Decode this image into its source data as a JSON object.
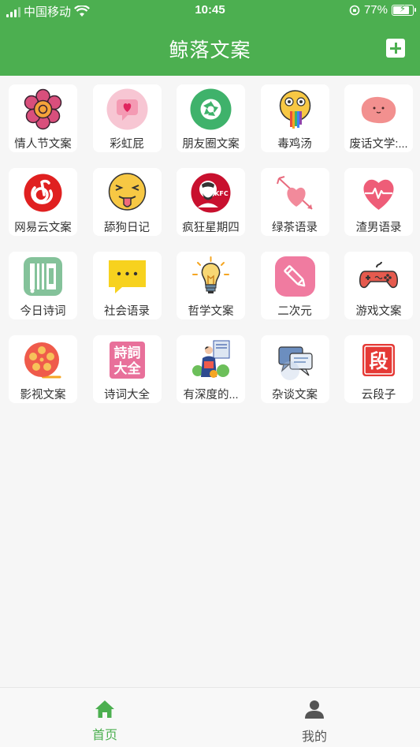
{
  "status_bar": {
    "carrier": "中国移动",
    "time": "10:45",
    "battery": "77%",
    "battery_level": 0.77
  },
  "header": {
    "title": "鲸落文案",
    "add_icon": "plus-square-icon"
  },
  "categories": [
    {
      "label": "情人节文案",
      "icon": "flower-icon"
    },
    {
      "label": "彩虹屁",
      "icon": "heart-chat-icon"
    },
    {
      "label": "朋友圈文案",
      "icon": "camera-aperture-icon"
    },
    {
      "label": "毒鸡汤",
      "icon": "rainbow-vomit-emoji-icon"
    },
    {
      "label": "废话文学:...",
      "icon": "pink-blob-face-icon"
    },
    {
      "label": "网易云文案",
      "icon": "netease-music-icon"
    },
    {
      "label": "舔狗日记",
      "icon": "tongue-out-emoji-icon"
    },
    {
      "label": "疯狂星期四",
      "icon": "kfc-icon"
    },
    {
      "label": "绿茶语录",
      "icon": "heart-arrow-icon"
    },
    {
      "label": "渣男语录",
      "icon": "heartbeat-icon"
    },
    {
      "label": "今日诗词",
      "icon": "poem-scroll-icon"
    },
    {
      "label": "社会语录",
      "icon": "speech-bubble-dots-icon"
    },
    {
      "label": "哲学文案",
      "icon": "lightbulb-icon"
    },
    {
      "label": "二次元",
      "icon": "pencil-icon"
    },
    {
      "label": "游戏文案",
      "icon": "gamepad-icon"
    },
    {
      "label": "影视文案",
      "icon": "film-reel-icon"
    },
    {
      "label": "诗词大全",
      "icon": "poetry-book-icon"
    },
    {
      "label": "有深度的...",
      "icon": "reading-person-icon"
    },
    {
      "label": "杂谈文案",
      "icon": "chat-bubbles-icon"
    },
    {
      "label": "云段子",
      "icon": "duan-character-icon"
    }
  ],
  "tabbar": {
    "home": {
      "label": "首页",
      "icon": "home-icon"
    },
    "me": {
      "label": "我的",
      "icon": "user-icon"
    }
  },
  "colors": {
    "primary": "#4caf50",
    "background": "#f6f6f6"
  }
}
